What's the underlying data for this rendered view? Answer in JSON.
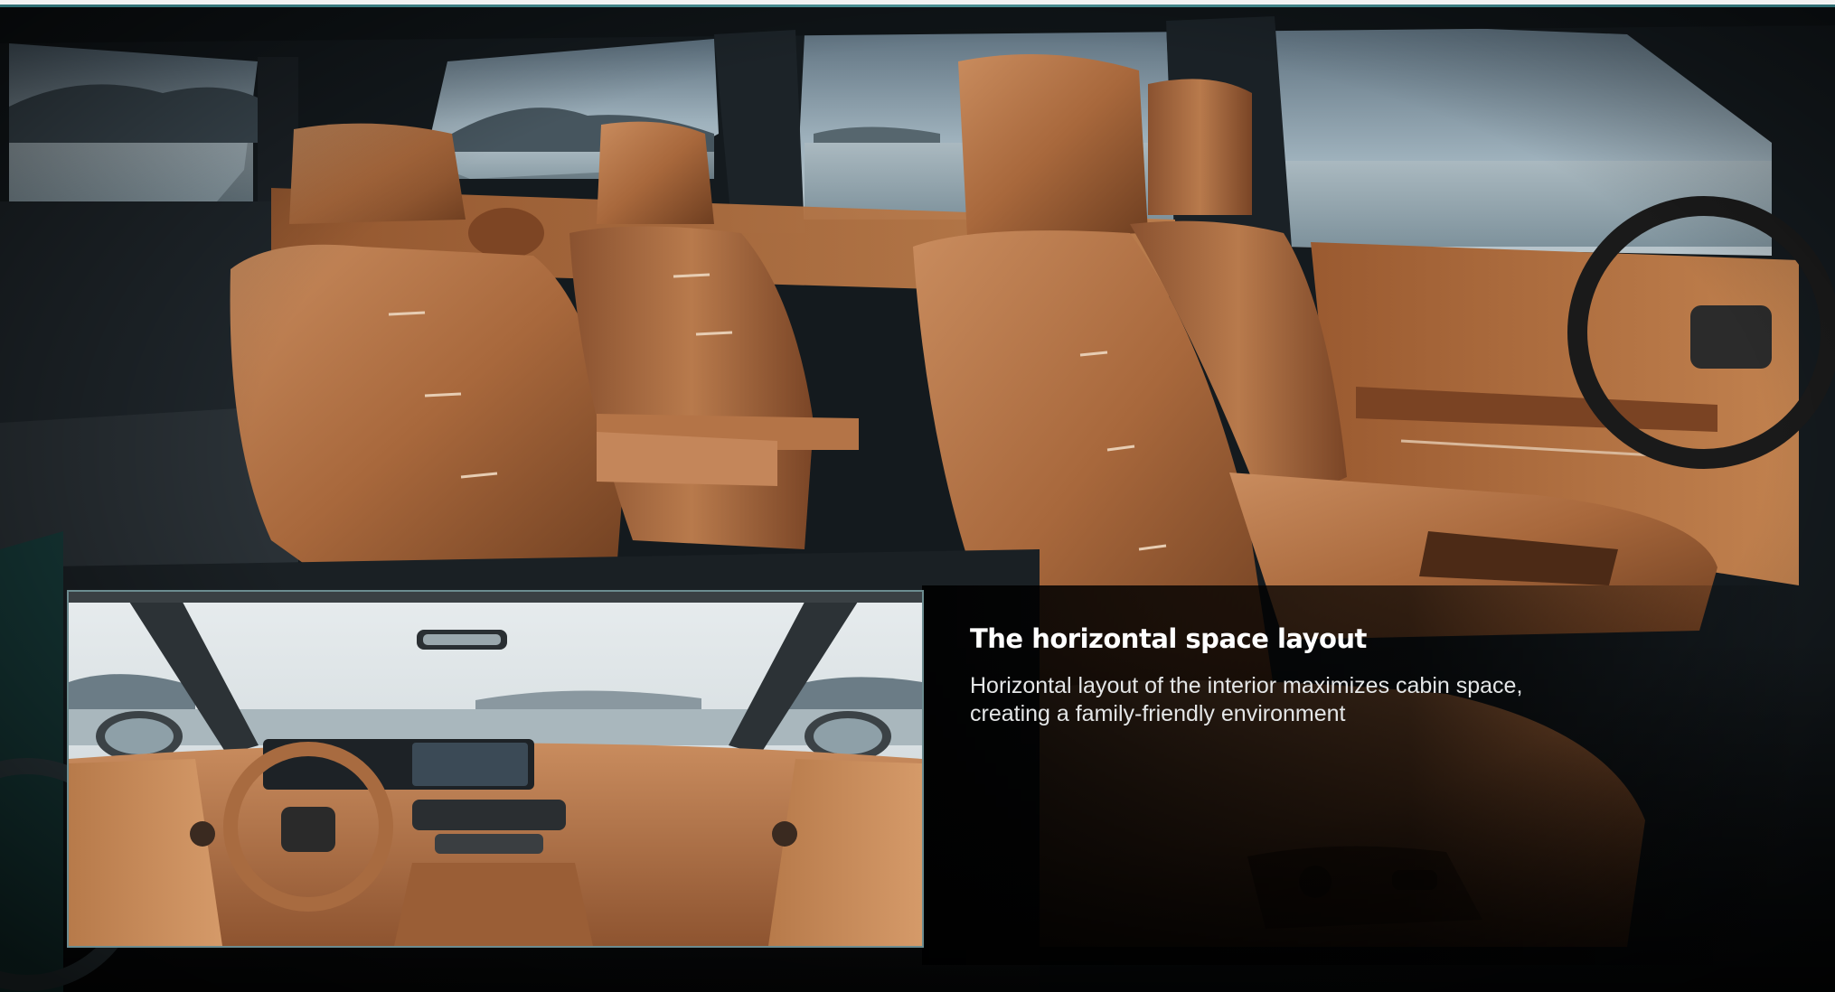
{
  "feature": {
    "title": "The horizontal space layout",
    "description": "Horizontal layout of the interior maximizes cabin space, creating a family-friendly environment"
  },
  "images": {
    "hero": {
      "subject": "side-view of three-row cabin with cognac leather seats"
    },
    "inset": {
      "subject": "front cabin view with steering wheel and dashboard"
    }
  },
  "colors": {
    "accent": "#3f7f84",
    "leather": "#a8683c",
    "leather_dark": "#6e3e20",
    "background": "#0b1216",
    "text": "#ffffff"
  }
}
